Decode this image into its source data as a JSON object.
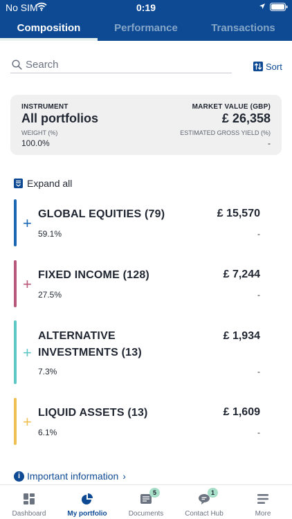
{
  "status_bar": {
    "carrier": "No SIM",
    "time": "0:19"
  },
  "tabs": [
    {
      "label": "Composition",
      "active": true
    },
    {
      "label": "Performance",
      "active": false
    },
    {
      "label": "Transactions",
      "active": false
    }
  ],
  "search": {
    "placeholder": "Search",
    "value": ""
  },
  "sort": {
    "label": "Sort"
  },
  "summary": {
    "instrument_label": "INSTRUMENT",
    "instrument_value": "All portfolios",
    "market_value_label": "MARKET VALUE (GBP)",
    "market_value": "£ 26,358",
    "weight_label": "WEIGHT (%)",
    "weight_value": "100.0%",
    "yield_label": "ESTIMATED GROSS YIELD (%)",
    "yield_value": "-"
  },
  "expand_all": {
    "label": "Expand all"
  },
  "asset_classes": [
    {
      "name": "GLOBAL EQUITIES (79)",
      "value": "£ 15,570",
      "weight": "59.1%",
      "yield": "-",
      "color": "#1b67b3"
    },
    {
      "name": "FIXED INCOME (128)",
      "value": "£ 7,244",
      "weight": "27.5%",
      "yield": "-",
      "color": "#b8587a"
    },
    {
      "name": "ALTERNATIVE INVESTMENTS (13)",
      "value": "£ 1,934",
      "weight": "7.3%",
      "yield": "-",
      "color": "#5ec8c6"
    },
    {
      "name": "LIQUID ASSETS (13)",
      "value": "£ 1,609",
      "weight": "6.1%",
      "yield": "-",
      "color": "#efc052"
    }
  ],
  "important_info": {
    "label": "Important information"
  },
  "bottom_nav": [
    {
      "label": "Dashboard",
      "icon": "dashboard-icon",
      "active": false,
      "badge": ""
    },
    {
      "label": "My portfolio",
      "icon": "pie-chart-icon",
      "active": true,
      "badge": ""
    },
    {
      "label": "Documents",
      "icon": "document-icon",
      "active": false,
      "badge": "5"
    },
    {
      "label": "Contact Hub",
      "icon": "chat-icon",
      "active": false,
      "badge": "1"
    },
    {
      "label": "More",
      "icon": "menu-icon",
      "active": false,
      "badge": ""
    }
  ],
  "colors": {
    "brand": "#0d4a93",
    "badge": "#a7dfc9"
  }
}
